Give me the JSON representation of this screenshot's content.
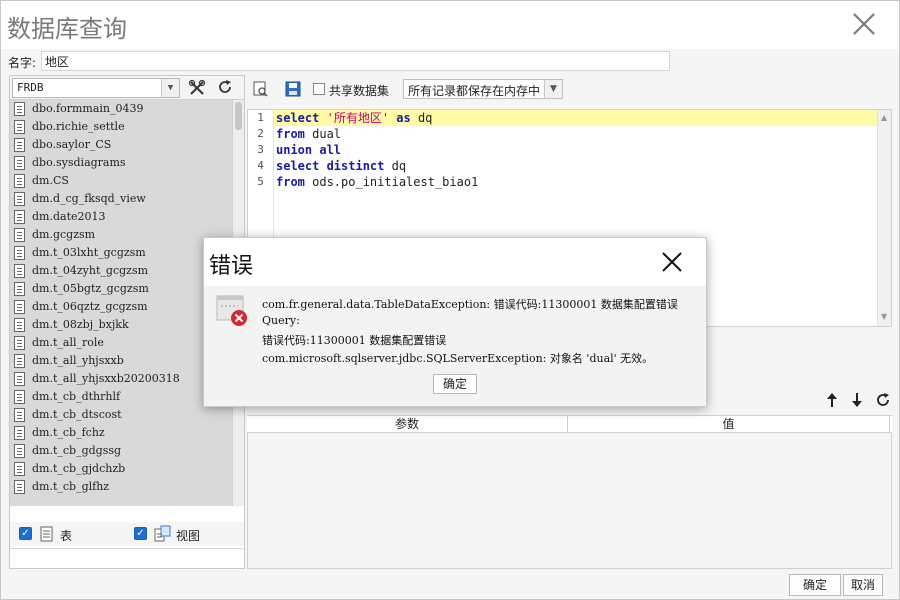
{
  "window": {
    "title": "数据库查询"
  },
  "name_row": {
    "label": "名字:",
    "value": "地区"
  },
  "left_panel": {
    "connection": "FRDB",
    "tables": [
      "dbo.formmain_0439",
      "dbo.richie_settle",
      "dbo.saylor_CS",
      "dbo.sysdiagrams",
      "dm.CS",
      "dm.d_cg_fksqd_view",
      "dm.date2013",
      "dm.gcgzsm",
      "dm.t_03lxht_gcgzsm",
      "dm.t_04zyht_gcgzsm",
      "dm.t_05bgtz_gcgzsm",
      "dm.t_06qztz_gcgzsm",
      "dm.t_08zbj_bxjkk",
      "dm.t_all_role",
      "dm.t_all_yhjsxxb",
      "dm.t_all_yhjsxxb20200318",
      "dm.t_cb_dthrhlf",
      "dm.t_cb_dtscost",
      "dm.t_cb_fchz",
      "dm.t_cb_gdgssg",
      "dm.t_cb_gjdchzb",
      "dm.t_cb_glfhz"
    ],
    "check_table_label": "表",
    "check_view_label": "视图"
  },
  "right_toolbar": {
    "share_label": "共享数据集",
    "memory_option": "所有记录都保存在内存中"
  },
  "editor": {
    "line_numbers": [
      "1",
      "2",
      "3",
      "4",
      "5"
    ]
  },
  "params": {
    "col_param": "参数",
    "col_value": "值"
  },
  "footer": {
    "ok_label": "确定",
    "cancel_label": "取消"
  },
  "dialog": {
    "title": "错误",
    "line1": "com.fr.general.data.TableDataException: 错误代码:11300001 数据集配置错误",
    "line2": "Query:",
    "line3": "错误代码:11300001 数据集配置错误",
    "line4": "com.microsoft.sqlserver.jdbc.SQLServerException: 对象名 'dual' 无效。",
    "ok_label": "确定"
  }
}
